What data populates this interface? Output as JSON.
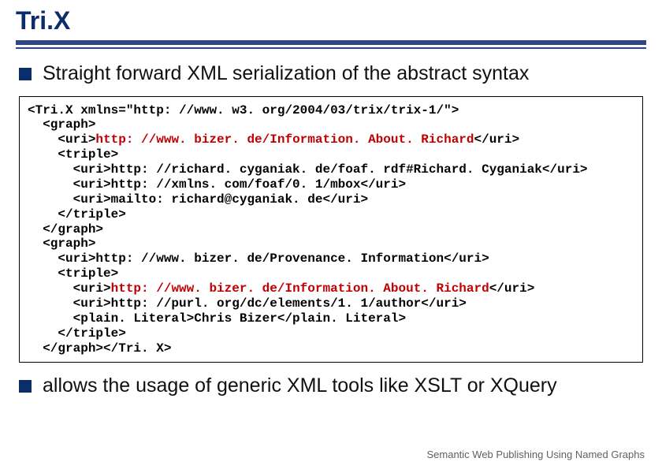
{
  "header": {
    "title": "Tri.X"
  },
  "bullets": {
    "first": "Straight forward XML serialization of the abstract syntax",
    "second": "allows the usage of generic XML tools like XSLT or XQuery"
  },
  "code": {
    "l01a": "<Tri.X xmlns=\"http: //www. w3. org/2004/03/trix/trix-1/\">",
    "l02a": "  <graph>",
    "l03a": "    <uri>",
    "l03b": "http: //www. bizer. de/Information. About. Richard",
    "l03c": "</uri>",
    "l04a": "    <triple>",
    "l05a": "      <uri>http: //richard. cyganiak. de/foaf. rdf#Richard. Cyganiak</uri>",
    "l06a": "      <uri>http: //xmlns. com/foaf/0. 1/mbox</uri>",
    "l07a": "      <uri>mailto: richard@cyganiak. de</uri>",
    "l08a": "    </triple>",
    "l09a": "  </graph>",
    "l10a": "  <graph>",
    "l11a": "    <uri>http: //www. bizer. de/Provenance. Information</uri>",
    "l12a": "    <triple>",
    "l13a": "      <uri>",
    "l13b": "http: //www. bizer. de/Information. About. Richard",
    "l13c": "</uri>",
    "l14a": "      <uri>http: //purl. org/dc/elements/1. 1/author</uri>",
    "l15a": "      <plain. Literal>Chris Bizer</plain. Literal>",
    "l16a": "    </triple>",
    "l17a": "  </graph></Tri. X>"
  },
  "footer": {
    "text": "Semantic Web Publishing Using Named Graphs"
  }
}
